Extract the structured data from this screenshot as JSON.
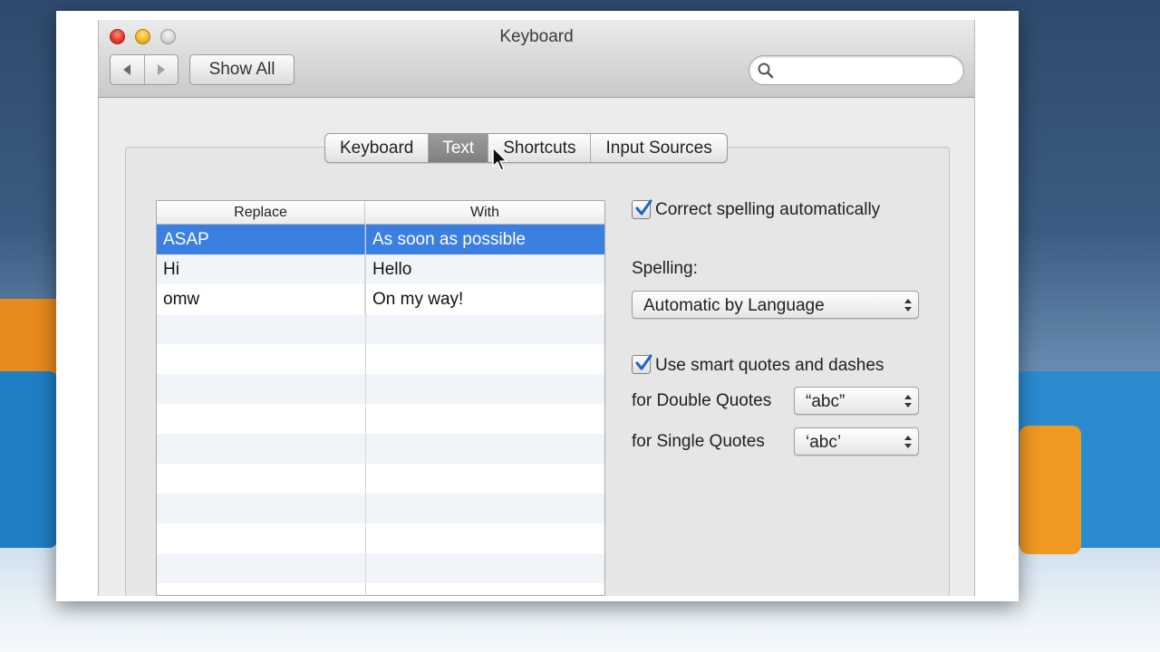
{
  "window": {
    "title": "Keyboard"
  },
  "toolbar": {
    "back_icon": "chevron-left-icon",
    "forward_icon": "chevron-right-icon",
    "show_all_label": "Show All",
    "search_placeholder": "",
    "search_value": ""
  },
  "tabs": [
    {
      "label": "Keyboard",
      "active": false
    },
    {
      "label": "Text",
      "active": true
    },
    {
      "label": "Shortcuts",
      "active": false
    },
    {
      "label": "Input Sources",
      "active": false
    }
  ],
  "replacements": {
    "columns": [
      "Replace",
      "With"
    ],
    "rows": [
      {
        "replace": "ASAP",
        "with": "As soon as possible",
        "selected": true
      },
      {
        "replace": "Hi",
        "with": "Hello",
        "selected": false
      },
      {
        "replace": "omw",
        "with": "On my way!",
        "selected": false
      }
    ]
  },
  "options": {
    "correct_spelling": {
      "label": "Correct spelling automatically",
      "checked": true
    },
    "spelling_label": "Spelling:",
    "spelling_value": "Automatic by Language",
    "smart_quotes": {
      "label": "Use smart quotes and dashes",
      "checked": true
    },
    "double_quotes_label": "for Double Quotes",
    "double_quotes_value": "“abc”",
    "single_quotes_label": "for Single Quotes",
    "single_quotes_value": "‘abc’"
  },
  "colors": {
    "selection": "#3b7fe0",
    "close": "#e0332a",
    "minimize": "#f2b31c"
  }
}
